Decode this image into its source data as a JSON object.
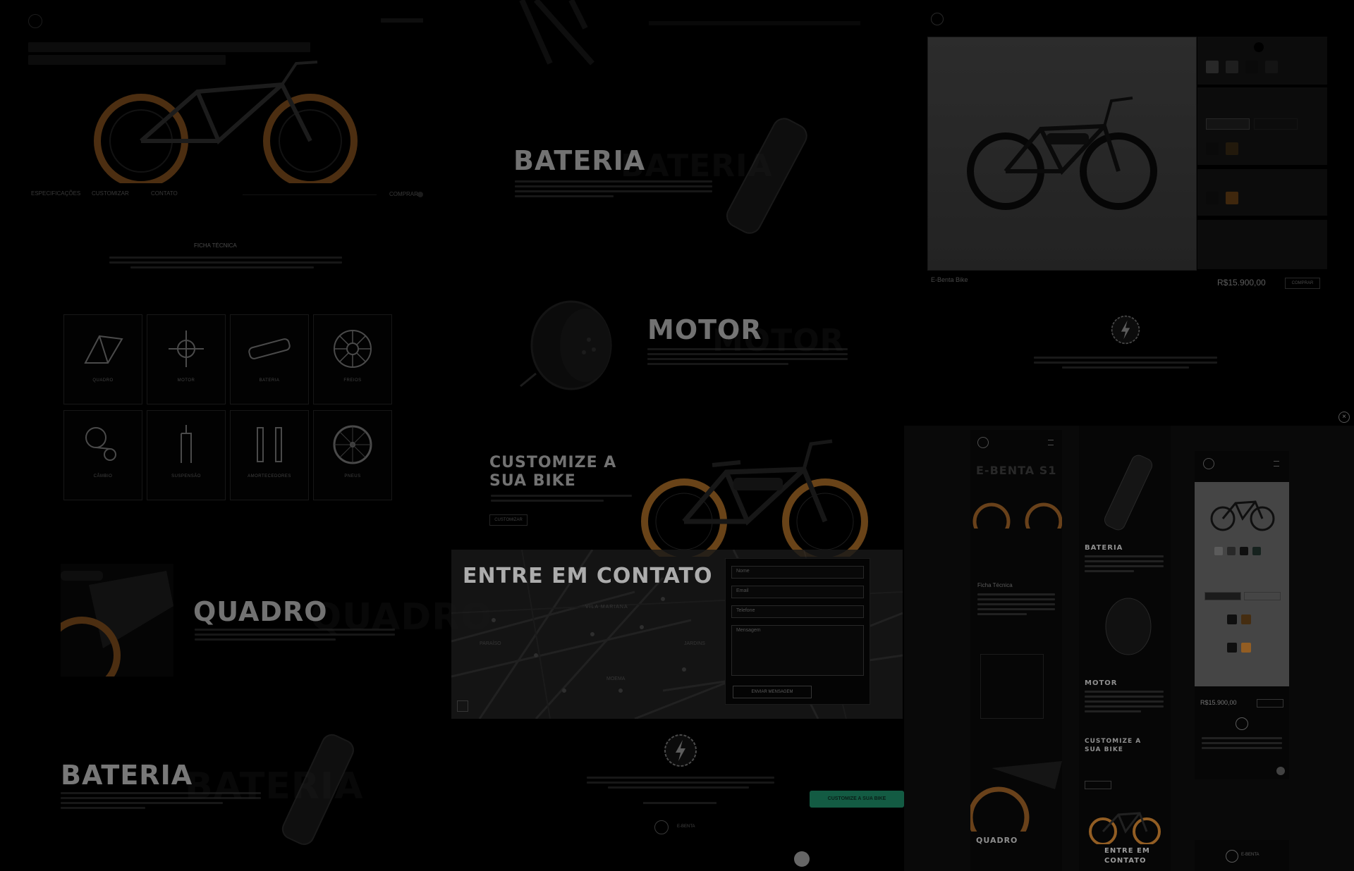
{
  "sections": {
    "quadro": {
      "title": "QUADRO",
      "ghost": "QUADRO"
    },
    "bateria_left": {
      "title": "BATERIA",
      "ghost": "BATERIA"
    },
    "bateria_top": {
      "title": "BATERIA",
      "ghost": "BATERIA"
    },
    "motor": {
      "title": "MOTOR",
      "ghost": "MOTOR"
    },
    "customize": {
      "title_line1": "CUSTOMIZE A",
      "title_line2": "SUA BIKE",
      "button": "CUSTOMIZAR"
    },
    "contato": {
      "title": "ENTRE EM CONTATO"
    }
  },
  "hero_nav": {
    "items": [
      "ESPECIFICAÇÕES",
      "CUSTOMIZAR",
      "CONTATO"
    ],
    "cta": "COMPRAR"
  },
  "ficha": {
    "title": "FICHA TÉCNICA",
    "items": [
      {
        "label": "QUADRO"
      },
      {
        "label": "MOTOR"
      },
      {
        "label": "BATERIA"
      },
      {
        "label": "FREIOS"
      },
      {
        "label": "CÂMBIO"
      },
      {
        "label": "SUSPENSÃO"
      },
      {
        "label": "AMORTECEDORES"
      },
      {
        "label": "PNEUS"
      }
    ]
  },
  "contact_form": {
    "name": "Nome",
    "email": "Email",
    "phone": "Telefone",
    "message": "Mensagem",
    "submit": "ENVIAR MENSAGEM"
  },
  "map_labels": [
    "VILA MARIANA",
    "PARAÍSO",
    "JARDINS",
    "MOEMA"
  ],
  "brand": {
    "name": "E-BENTA"
  },
  "product": {
    "name": "E-Benta Bike",
    "price": "R$15.900,00",
    "buy": "COMPRAR"
  },
  "green_cta": "CUSTOMIZE A SUA BIKE",
  "mobile": {
    "screen1_title": "E-BENTA S1",
    "ficha": "Ficha Técnica",
    "bateria": "BATERIA",
    "motor": "MOTOR",
    "customize": "CUSTOMIZE A SUA BIKE",
    "contato_line1": "ENTRE EM",
    "contato_line2": "CONTATO",
    "quadro": "QUADRO",
    "price": "R$15.900,00"
  },
  "colors": {
    "orange": "#c07a2c",
    "green": "#1a7a5a",
    "bg": "#000000",
    "panel": "#141414"
  }
}
